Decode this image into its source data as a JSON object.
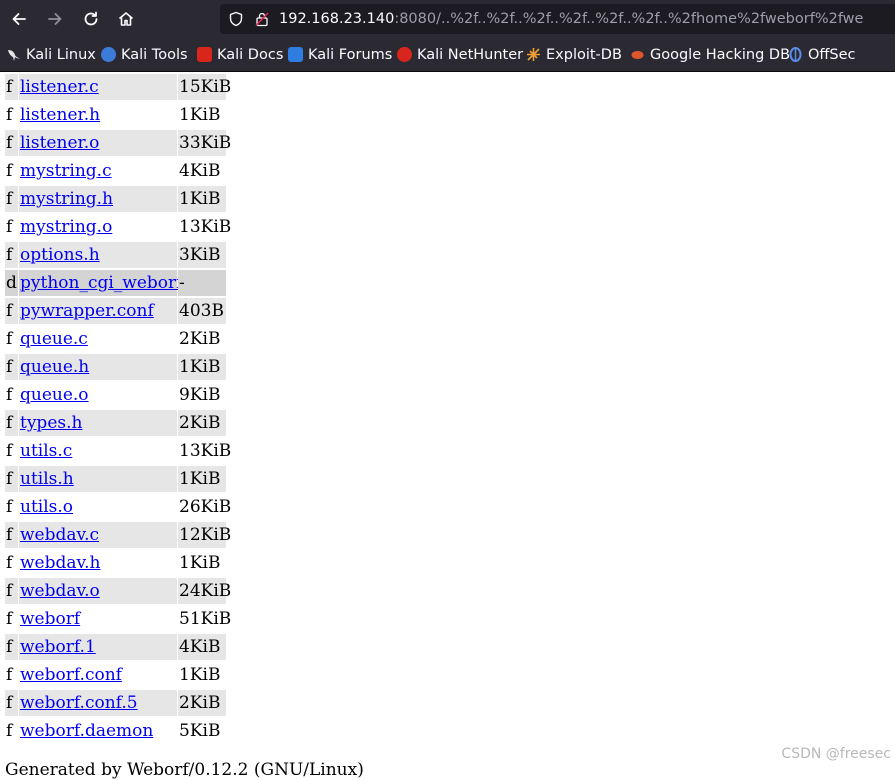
{
  "browser": {
    "url_host": "192.168.23.140",
    "url_rest": ":8080/..%2f..%2f..%2f..%2f..%2f..%2f..%2fhome%2fweborf%2fwe",
    "bookmarks": [
      {
        "label": "Kali Linux",
        "icon": "kali-dragon-icon",
        "color": "#e6e6e6"
      },
      {
        "label": "Kali Tools",
        "icon": "kali-tools-icon",
        "color": "#3d7bd9"
      },
      {
        "label": "Kali Docs",
        "icon": "kali-docs-icon",
        "color": "#d9261c"
      },
      {
        "label": "Kali Forums",
        "icon": "kali-forums-icon",
        "color": "#2f7de1"
      },
      {
        "label": "Kali NetHunter",
        "icon": "nethunter-icon",
        "color": "#d9261c"
      },
      {
        "label": "Exploit-DB",
        "icon": "exploit-db-icon",
        "color": "#f0a030"
      },
      {
        "label": "Google Hacking DB",
        "icon": "ghdb-icon",
        "color": "#e0552b"
      },
      {
        "label": "OffSec",
        "icon": "offsec-icon",
        "color": "#5b8de8"
      }
    ]
  },
  "files": [
    {
      "type": "f",
      "name": "listener.c",
      "size": "15KiB"
    },
    {
      "type": "f",
      "name": "listener.h",
      "size": "1KiB"
    },
    {
      "type": "f",
      "name": "listener.o",
      "size": "33KiB"
    },
    {
      "type": "f",
      "name": "mystring.c",
      "size": "4KiB"
    },
    {
      "type": "f",
      "name": "mystring.h",
      "size": "1KiB"
    },
    {
      "type": "f",
      "name": "mystring.o",
      "size": "13KiB"
    },
    {
      "type": "f",
      "name": "options.h",
      "size": "3KiB"
    },
    {
      "type": "d",
      "name": "python_cgi_weborf/",
      "size": "-"
    },
    {
      "type": "f",
      "name": "pywrapper.conf",
      "size": "403B"
    },
    {
      "type": "f",
      "name": "queue.c",
      "size": "2KiB"
    },
    {
      "type": "f",
      "name": "queue.h",
      "size": "1KiB"
    },
    {
      "type": "f",
      "name": "queue.o",
      "size": "9KiB"
    },
    {
      "type": "f",
      "name": "types.h",
      "size": "2KiB"
    },
    {
      "type": "f",
      "name": "utils.c",
      "size": "13KiB"
    },
    {
      "type": "f",
      "name": "utils.h",
      "size": "1KiB"
    },
    {
      "type": "f",
      "name": "utils.o",
      "size": "26KiB"
    },
    {
      "type": "f",
      "name": "webdav.c",
      "size": "12KiB"
    },
    {
      "type": "f",
      "name": "webdav.h",
      "size": "1KiB"
    },
    {
      "type": "f",
      "name": "webdav.o",
      "size": "24KiB"
    },
    {
      "type": "f",
      "name": "weborf",
      "size": "51KiB"
    },
    {
      "type": "f",
      "name": "weborf.1",
      "size": "4KiB"
    },
    {
      "type": "f",
      "name": "weborf.conf",
      "size": "1KiB"
    },
    {
      "type": "f",
      "name": "weborf.conf.5",
      "size": "2KiB"
    },
    {
      "type": "f",
      "name": "weborf.daemon",
      "size": "5KiB"
    }
  ],
  "footer": "Generated by Weborf/0.12.2 (GNU/Linux)",
  "watermark": "CSDN @freesec"
}
